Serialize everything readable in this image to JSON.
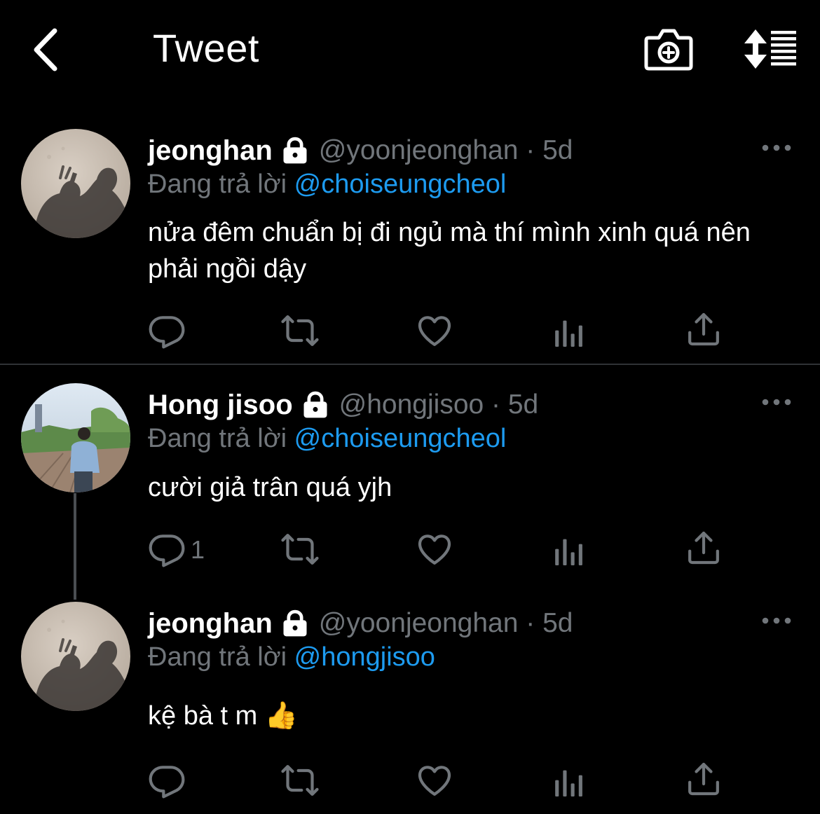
{
  "header": {
    "title": "Tweet",
    "back_icon": "chevron-left-icon",
    "camera_icon": "camera-plus-icon",
    "sort_icon": "sort-list-icon"
  },
  "colors": {
    "background": "#000000",
    "mention": "#1d9bf0",
    "muted": "#71767b",
    "text": "#ffffff"
  },
  "tweets": [
    {
      "name": "jeonghan",
      "handle": "@yoonjeonghan · 5d",
      "reply_prefix": "Đang trả lời",
      "reply_to": "@choiseungcheol",
      "text": "nửa đêm chuẩn bị đi ngủ mà thí mình xinh quá nên phải ngồi dậy",
      "reply_count": ""
    },
    {
      "name": "Hong jisoo",
      "handle": "@hongjisoo · 5d",
      "reply_prefix": "Đang trả lời",
      "reply_to": "@choiseungcheol",
      "text": "cười giả trân quá yjh",
      "reply_count": "1"
    },
    {
      "name": "jeonghan",
      "handle": "@yoonjeonghan · 5d",
      "reply_prefix": "Đang trả lời",
      "reply_to": "@hongjisoo",
      "text": "kệ bà t m 👍",
      "reply_count": ""
    }
  ]
}
